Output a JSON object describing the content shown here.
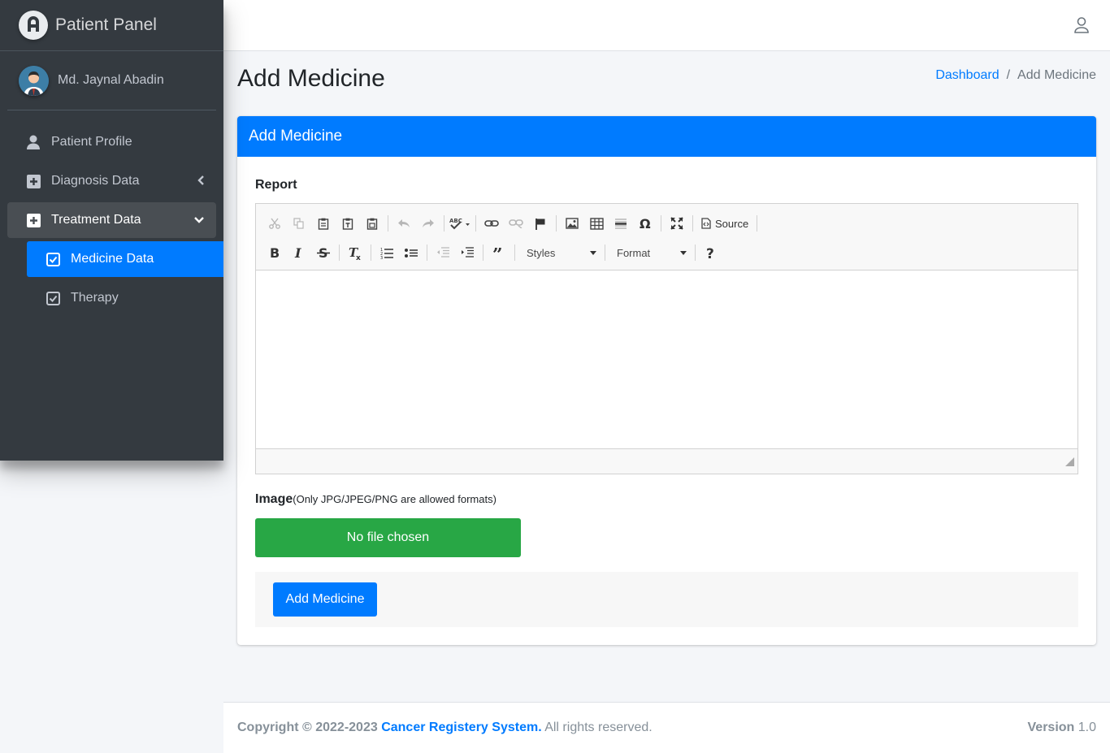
{
  "brand": {
    "title": "Patient Panel"
  },
  "user": {
    "name": "Md. Jaynal Abadin"
  },
  "sidebar": {
    "items": [
      {
        "label": "Patient Profile",
        "icon": "user-icon"
      },
      {
        "label": "Diagnosis Data",
        "icon": "plus-square-icon"
      },
      {
        "label": "Treatment Data",
        "icon": "plus-square-icon"
      }
    ],
    "treatment_sub": [
      {
        "label": "Medicine Data",
        "icon": "check-square-icon",
        "active": true
      },
      {
        "label": "Therapy",
        "icon": "check-square-icon",
        "active": false
      }
    ]
  },
  "header": {
    "title": "Add Medicine",
    "breadcrumb": {
      "home": "Dashboard",
      "current": "Add Medicine"
    }
  },
  "card": {
    "title": "Add Medicine",
    "report_label": "Report",
    "editor": {
      "source_label": "Source",
      "styles_label": "Styles",
      "format_label": "Format"
    },
    "image_label": "Image",
    "image_hint": "(Only JPG/JPEG/PNG are allowed formats)",
    "file_button": "No file chosen",
    "submit_label": "Add Medicine"
  },
  "footer": {
    "copyright_prefix": "Copyright © 2022-2023",
    "system_name": "Cancer Registery System.",
    "rights": " All rights reserved.",
    "version_label": "Version",
    "version_value": " 1.0"
  },
  "colors": {
    "primary": "#007bff",
    "success": "#28a745",
    "sidebar": "#343a40"
  }
}
